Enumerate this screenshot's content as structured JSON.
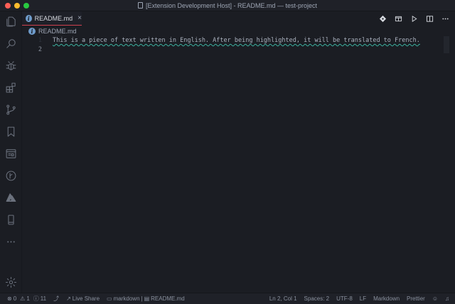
{
  "window": {
    "title": "[Extension Development Host] - README.md — test-project"
  },
  "activity_bar": {
    "icons": [
      "files-icon",
      "search-icon",
      "debug-icon",
      "extensions-icon",
      "source-control-icon",
      "bookmark-icon",
      "browser-preview-icon",
      "git-graph-icon",
      "azure-icon",
      "mobile-icon",
      "more-icon",
      "settings-gear-icon"
    ]
  },
  "tab": {
    "label": "README.md",
    "close": "×"
  },
  "breadcrumb": {
    "label": "README.md"
  },
  "editor": {
    "lines": [
      {
        "number": "1",
        "text": "This is a piece of text written in English. After being highlighted, it will be translated to French."
      },
      {
        "number": "2",
        "text": ""
      }
    ]
  },
  "status_bar": {
    "errors": "0",
    "warnings": "1",
    "info": "11",
    "live_share": "Live Share",
    "language_breadcrumb": "markdown",
    "file": "README.md",
    "position": "Ln 2, Col 1",
    "spaces": "Spaces: 2",
    "encoding": "UTF-8",
    "eol": "LF",
    "language": "Markdown",
    "formatter": "Prettier"
  },
  "colors": {
    "accent_tab": "#d0414f",
    "squiggle": "#3bb3a0",
    "info": "#6f9ccb"
  }
}
